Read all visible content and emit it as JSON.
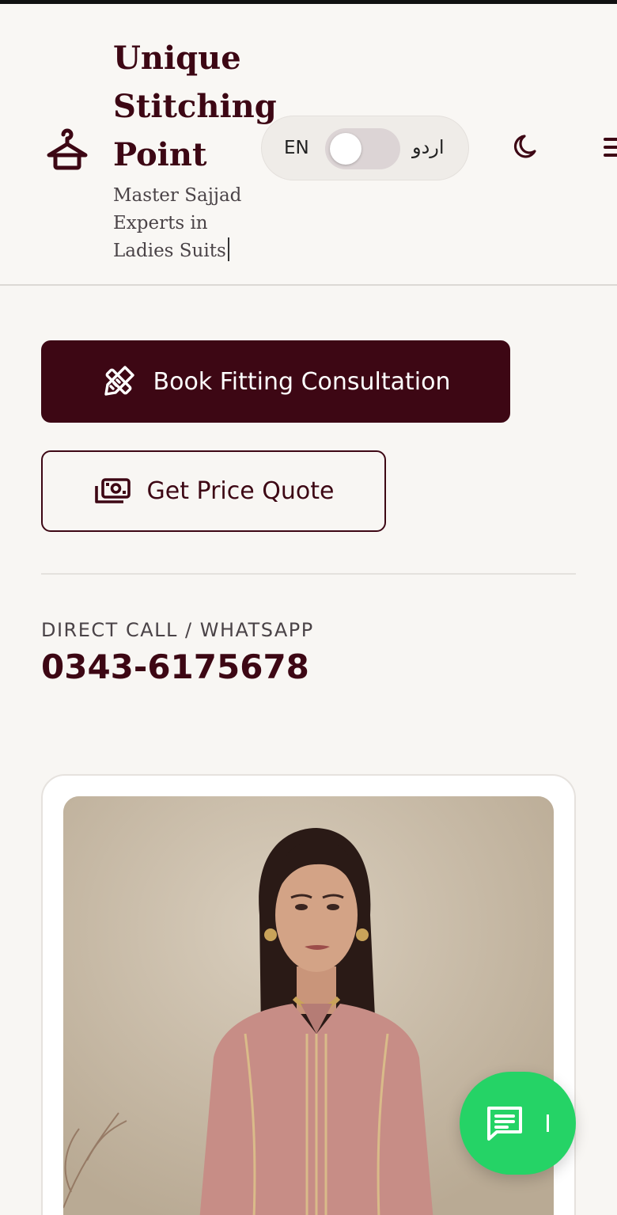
{
  "header": {
    "brand_name": "Unique Stitching Point",
    "brand_subtitle": "Master Sajjad Experts in Ladies Suits",
    "lang_en": "EN",
    "lang_ur": "اردو"
  },
  "actions": {
    "primary_label": "Book Fitting Consultation",
    "secondary_label": "Get Price Quote"
  },
  "contact": {
    "label": "DIRECT CALL / WHATSAPP",
    "phone": "0343-6175678"
  },
  "icons": {
    "logo": "hanger-icon",
    "theme": "moon-icon",
    "menu": "menu-icon",
    "primary": "ruler-pencil-icon",
    "secondary": "cash-icon",
    "chat": "chat-bubble-icon"
  },
  "colors": {
    "brand": "#3d0714",
    "background": "#f8f6f3",
    "chat": "#25d366"
  }
}
